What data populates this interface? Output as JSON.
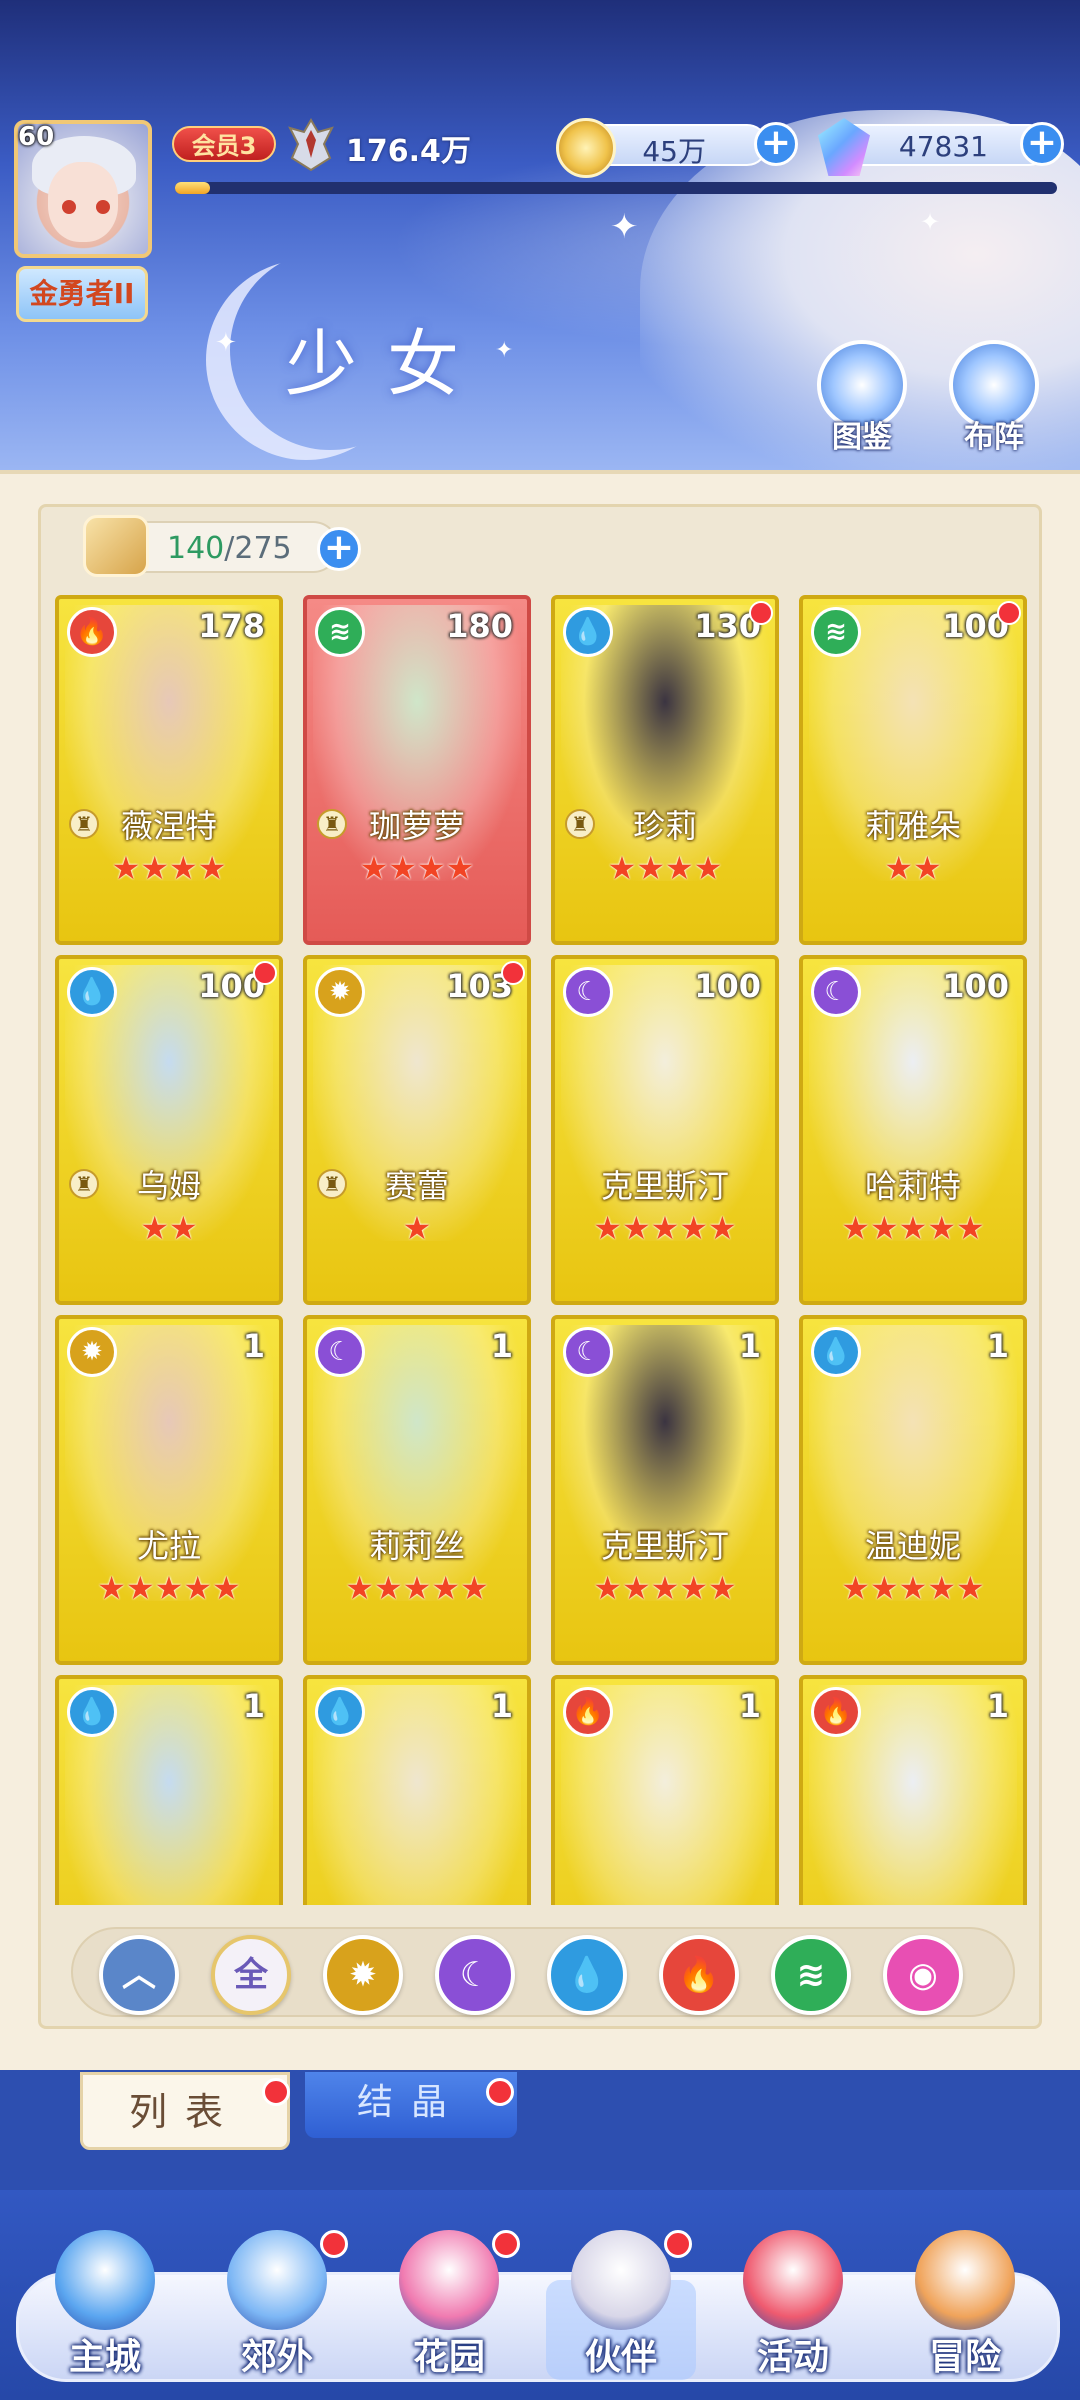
{
  "header": {
    "level": "60",
    "title_badge": "金勇者II",
    "vip": "会员3",
    "power": "176.4万",
    "exp_progress": 0.04,
    "gold": "45万",
    "gems": "47831",
    "page_title": "少女",
    "codex_label": "图鉴",
    "formation_label": "布阵"
  },
  "roster": {
    "count": "140",
    "capacity": "275",
    "separator": "/"
  },
  "cards": [
    {
      "name": "薇涅特",
      "level": "178",
      "element": "fire",
      "stars": "★★★★",
      "dot": false,
      "chess": true
    },
    {
      "name": "珈萝萝",
      "level": "180",
      "element": "wind",
      "stars": "★★★★",
      "dot": false,
      "chess": true,
      "red": true
    },
    {
      "name": "珍莉",
      "level": "130",
      "element": "water",
      "stars": "★★★★",
      "dot": true,
      "chess": true
    },
    {
      "name": "莉雅朵",
      "level": "100",
      "element": "wind",
      "stars": "★★",
      "dot": true,
      "chess": false
    },
    {
      "name": "乌姆",
      "level": "100",
      "element": "water",
      "stars": "★★",
      "dot": true,
      "chess": true
    },
    {
      "name": "赛蕾",
      "level": "103",
      "element": "light",
      "stars": "★",
      "dot": true,
      "chess": true
    },
    {
      "name": "克里斯汀",
      "level": "100",
      "element": "dark",
      "stars": "★★★★★",
      "dot": false,
      "chess": false
    },
    {
      "name": "哈莉特",
      "level": "100",
      "element": "dark",
      "stars": "★★★★★",
      "dot": false,
      "chess": false
    },
    {
      "name": "尤拉",
      "level": "1",
      "element": "light",
      "stars": "★★★★★",
      "dot": false,
      "chess": false
    },
    {
      "name": "莉莉丝",
      "level": "1",
      "element": "dark",
      "stars": "★★★★★",
      "dot": false,
      "chess": false
    },
    {
      "name": "克里斯汀",
      "level": "1",
      "element": "dark",
      "stars": "★★★★★",
      "dot": false,
      "chess": false
    },
    {
      "name": "温迪妮",
      "level": "1",
      "element": "water",
      "stars": "★★★★★",
      "dot": false,
      "chess": false
    },
    {
      "name": "",
      "level": "1",
      "element": "water",
      "stars": "",
      "dot": false,
      "chess": false
    },
    {
      "name": "",
      "level": "1",
      "element": "water",
      "stars": "",
      "dot": false,
      "chess": false
    },
    {
      "name": "",
      "level": "1",
      "element": "fire",
      "stars": "",
      "dot": false,
      "chess": false
    },
    {
      "name": "",
      "level": "1",
      "element": "fire",
      "stars": "",
      "dot": false,
      "chess": false
    }
  ],
  "filters": [
    {
      "id": "sort",
      "label": "",
      "icon": "chevron-up-icon"
    },
    {
      "id": "all",
      "label": "全",
      "icon": "all-icon"
    },
    {
      "id": "light",
      "label": "",
      "icon": "sun-icon"
    },
    {
      "id": "dark",
      "label": "",
      "icon": "moon-icon"
    },
    {
      "id": "water",
      "label": "",
      "icon": "water-drop-icon"
    },
    {
      "id": "fire",
      "label": "",
      "icon": "flame-icon"
    },
    {
      "id": "wind",
      "label": "",
      "icon": "tornado-icon"
    },
    {
      "id": "special",
      "label": "",
      "icon": "orb-icon"
    }
  ],
  "tabs": {
    "list": "列表",
    "crystal": "结晶"
  },
  "nav": [
    {
      "label": "主城",
      "dot": false
    },
    {
      "label": "郊外",
      "dot": true
    },
    {
      "label": "花园",
      "dot": true
    },
    {
      "label": "伙伴",
      "dot": true,
      "active": true
    },
    {
      "label": "活动",
      "dot": false
    },
    {
      "label": "冒险",
      "dot": false
    }
  ],
  "colors": {
    "fire": "#e6463b",
    "water": "#2f9be0",
    "wind": "#2fae58",
    "light": "#d8a21c",
    "dark": "#8a4fd6",
    "special": "#e84fb3",
    "sort": "#5a86c9",
    "card_gold": "#f2d52a",
    "accent_blue": "#3b8ef0"
  },
  "element_glyphs": {
    "fire": "🔥",
    "water": "💧",
    "wind": "≋",
    "light": "✹",
    "dark": "☾"
  }
}
